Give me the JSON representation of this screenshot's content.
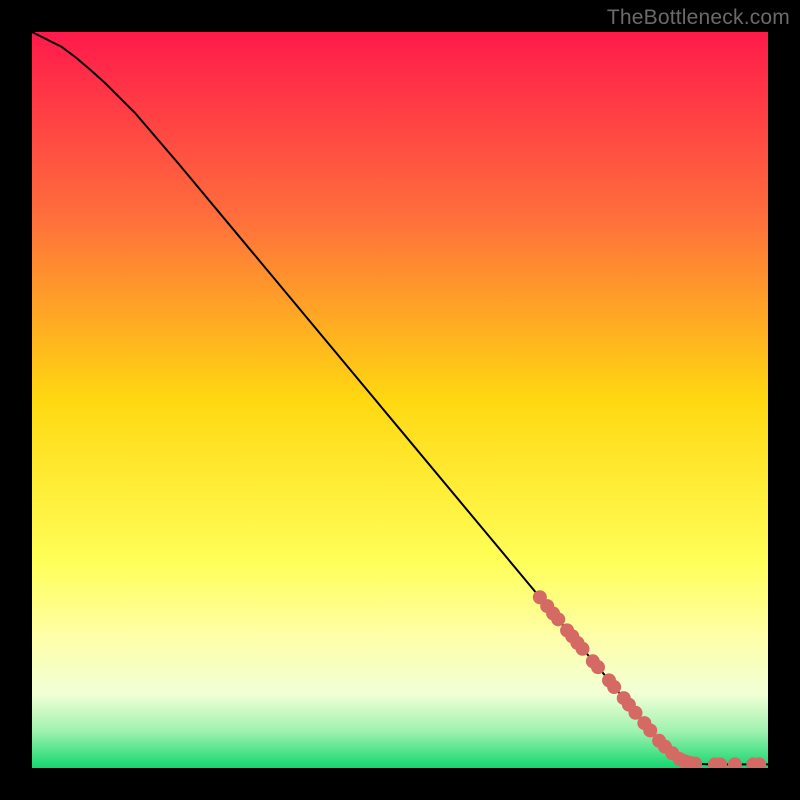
{
  "attribution": "TheBottleneck.com",
  "chart_data": {
    "type": "line",
    "title": "",
    "xlabel": "",
    "ylabel": "",
    "xlim": [
      0,
      100
    ],
    "ylim": [
      0,
      100
    ],
    "gradient_stops": [
      {
        "pos": 0,
        "color": "#ff1a4b"
      },
      {
        "pos": 25,
        "color": "#ff6e3c"
      },
      {
        "pos": 50,
        "color": "#ffd811"
      },
      {
        "pos": 72,
        "color": "#ffff58"
      },
      {
        "pos": 82,
        "color": "#ffffa8"
      },
      {
        "pos": 90,
        "color": "#f0ffd6"
      },
      {
        "pos": 95,
        "color": "#9ff2b0"
      },
      {
        "pos": 100,
        "color": "#13d76f"
      }
    ],
    "curve_points": [
      {
        "x": 0,
        "y": 100
      },
      {
        "x": 2,
        "y": 99
      },
      {
        "x": 4,
        "y": 98
      },
      {
        "x": 6,
        "y": 96.5
      },
      {
        "x": 8,
        "y": 94.8
      },
      {
        "x": 10,
        "y": 93.0
      },
      {
        "x": 14,
        "y": 89.0
      },
      {
        "x": 20,
        "y": 82.0
      },
      {
        "x": 30,
        "y": 70.0
      },
      {
        "x": 40,
        "y": 58.0
      },
      {
        "x": 50,
        "y": 46.0
      },
      {
        "x": 60,
        "y": 34.0
      },
      {
        "x": 70,
        "y": 22.0
      },
      {
        "x": 78,
        "y": 12.4
      },
      {
        "x": 82,
        "y": 7.5
      },
      {
        "x": 85,
        "y": 4.0
      },
      {
        "x": 87,
        "y": 2.0
      },
      {
        "x": 88,
        "y": 1.2
      },
      {
        "x": 89,
        "y": 0.8
      },
      {
        "x": 90,
        "y": 0.6
      },
      {
        "x": 92,
        "y": 0.5
      },
      {
        "x": 95,
        "y": 0.5
      },
      {
        "x": 98,
        "y": 0.5
      },
      {
        "x": 100,
        "y": 0.5
      }
    ],
    "series": [
      {
        "name": "markers",
        "color": "#d46a63",
        "points": [
          {
            "x": 69.0,
            "y": 23.2
          },
          {
            "x": 70.0,
            "y": 22.0
          },
          {
            "x": 70.8,
            "y": 21.0
          },
          {
            "x": 71.5,
            "y": 20.2
          },
          {
            "x": 72.7,
            "y": 18.7
          },
          {
            "x": 73.4,
            "y": 17.9
          },
          {
            "x": 74.1,
            "y": 17.0
          },
          {
            "x": 74.8,
            "y": 16.2
          },
          {
            "x": 76.2,
            "y": 14.5
          },
          {
            "x": 76.9,
            "y": 13.7
          },
          {
            "x": 78.4,
            "y": 11.9
          },
          {
            "x": 79.1,
            "y": 11.0
          },
          {
            "x": 80.4,
            "y": 9.5
          },
          {
            "x": 81.1,
            "y": 8.6
          },
          {
            "x": 82.0,
            "y": 7.5
          },
          {
            "x": 83.2,
            "y": 6.1
          },
          {
            "x": 84.0,
            "y": 5.1
          },
          {
            "x": 85.2,
            "y": 3.7
          },
          {
            "x": 86.0,
            "y": 2.9
          },
          {
            "x": 87.0,
            "y": 2.0
          },
          {
            "x": 88.0,
            "y": 1.2
          },
          {
            "x": 88.7,
            "y": 0.9
          },
          {
            "x": 89.4,
            "y": 0.7
          },
          {
            "x": 90.1,
            "y": 0.6
          },
          {
            "x": 92.8,
            "y": 0.5
          },
          {
            "x": 93.5,
            "y": 0.5
          },
          {
            "x": 95.5,
            "y": 0.5
          },
          {
            "x": 98.0,
            "y": 0.5
          },
          {
            "x": 98.8,
            "y": 0.5
          }
        ]
      }
    ]
  }
}
